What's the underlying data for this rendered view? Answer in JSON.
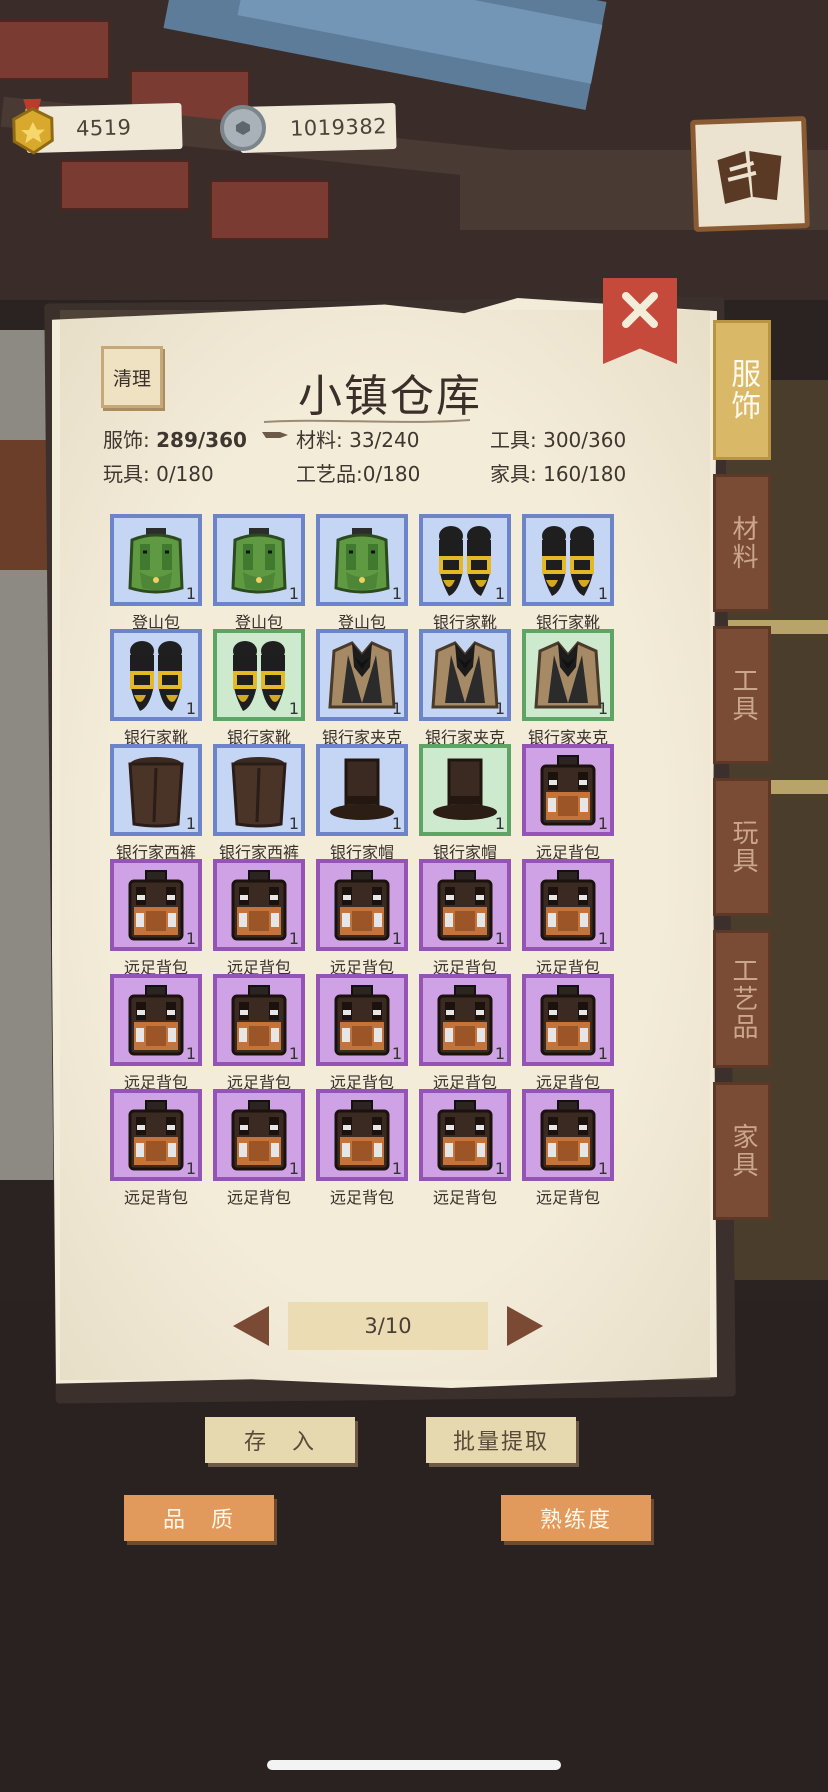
{
  "currencies": {
    "gold": {
      "value": "4519",
      "icon": "gold-medal-icon"
    },
    "silver": {
      "value": "1019382",
      "icon": "silver-coin-icon"
    }
  },
  "buttons": {
    "clean": "清理",
    "deposit": "存　入",
    "batch_withdraw": "批量提取",
    "quality": "品　质",
    "proficiency": "熟练度"
  },
  "title": "小镇仓库",
  "stats": {
    "clothing_label": "服饰:",
    "clothing_value": "289/360",
    "materials": "材料: 33/240",
    "tools": "工具: 300/360",
    "toys": "玩具: 0/180",
    "crafts": "工艺品:0/180",
    "furniture": "家具: 160/180"
  },
  "tabs": [
    {
      "label": "服饰",
      "active": true
    },
    {
      "label": "材料",
      "active": false
    },
    {
      "label": "工具",
      "active": false
    },
    {
      "label": "玩具",
      "active": false
    },
    {
      "label": "工艺品",
      "active": false
    },
    {
      "label": "家具",
      "active": false
    }
  ],
  "pagination": {
    "current": "3/10"
  },
  "items": [
    {
      "name": "登山包",
      "qty": "1",
      "rarity": "blue",
      "icon": "green-backpack-icon"
    },
    {
      "name": "登山包",
      "qty": "1",
      "rarity": "blue",
      "icon": "green-backpack-icon"
    },
    {
      "name": "登山包",
      "qty": "1",
      "rarity": "blue",
      "icon": "green-backpack-icon"
    },
    {
      "name": "银行家靴",
      "qty": "1",
      "rarity": "blue",
      "icon": "black-boots-icon"
    },
    {
      "name": "银行家靴",
      "qty": "1",
      "rarity": "blue",
      "icon": "black-boots-icon"
    },
    {
      "name": "银行家靴",
      "qty": "1",
      "rarity": "blue",
      "icon": "black-boots-icon"
    },
    {
      "name": "银行家靴",
      "qty": "1",
      "rarity": "green",
      "icon": "black-boots-icon"
    },
    {
      "name": "银行家夹克",
      "qty": "1",
      "rarity": "blue",
      "icon": "jacket-icon"
    },
    {
      "name": "银行家夹克",
      "qty": "1",
      "rarity": "blue",
      "icon": "jacket-icon"
    },
    {
      "name": "银行家夹克",
      "qty": "1",
      "rarity": "green",
      "icon": "jacket-icon"
    },
    {
      "name": "银行家西裤",
      "qty": "1",
      "rarity": "blue",
      "icon": "trousers-icon"
    },
    {
      "name": "银行家西裤",
      "qty": "1",
      "rarity": "blue",
      "icon": "trousers-icon"
    },
    {
      "name": "银行家帽",
      "qty": "1",
      "rarity": "blue",
      "icon": "top-hat-icon"
    },
    {
      "name": "银行家帽",
      "qty": "1",
      "rarity": "green",
      "icon": "top-hat-icon"
    },
    {
      "name": "远足背包",
      "qty": "1",
      "rarity": "purple",
      "icon": "brown-backpack-icon"
    },
    {
      "name": "远足背包",
      "qty": "1",
      "rarity": "purple",
      "icon": "brown-backpack-icon"
    },
    {
      "name": "远足背包",
      "qty": "1",
      "rarity": "purple",
      "icon": "brown-backpack-icon"
    },
    {
      "name": "远足背包",
      "qty": "1",
      "rarity": "purple",
      "icon": "brown-backpack-icon"
    },
    {
      "name": "远足背包",
      "qty": "1",
      "rarity": "purple",
      "icon": "brown-backpack-icon"
    },
    {
      "name": "远足背包",
      "qty": "1",
      "rarity": "purple",
      "icon": "brown-backpack-icon"
    },
    {
      "name": "远足背包",
      "qty": "1",
      "rarity": "purple",
      "icon": "brown-backpack-icon"
    },
    {
      "name": "远足背包",
      "qty": "1",
      "rarity": "purple",
      "icon": "brown-backpack-icon"
    },
    {
      "name": "远足背包",
      "qty": "1",
      "rarity": "purple",
      "icon": "brown-backpack-icon"
    },
    {
      "name": "远足背包",
      "qty": "1",
      "rarity": "purple",
      "icon": "brown-backpack-icon"
    },
    {
      "name": "远足背包",
      "qty": "1",
      "rarity": "purple",
      "icon": "brown-backpack-icon"
    },
    {
      "name": "远足背包",
      "qty": "1",
      "rarity": "purple",
      "icon": "brown-backpack-icon"
    },
    {
      "name": "远足背包",
      "qty": "1",
      "rarity": "purple",
      "icon": "brown-backpack-icon"
    },
    {
      "name": "远足背包",
      "qty": "1",
      "rarity": "purple",
      "icon": "brown-backpack-icon"
    },
    {
      "name": "远足背包",
      "qty": "1",
      "rarity": "purple",
      "icon": "brown-backpack-icon"
    },
    {
      "name": "远足背包",
      "qty": "1",
      "rarity": "purple",
      "icon": "brown-backpack-icon"
    }
  ],
  "colors": {
    "rarity_blue": "#6d84c9",
    "rarity_green": "#5ea465",
    "rarity_purple": "#9454b6",
    "panel_paper": "#f3ecd9",
    "tab_active": "#d9b867",
    "tab_inactive": "#7a4b35",
    "close_red": "#c54a3b",
    "button_orange": "#e29a5c"
  }
}
